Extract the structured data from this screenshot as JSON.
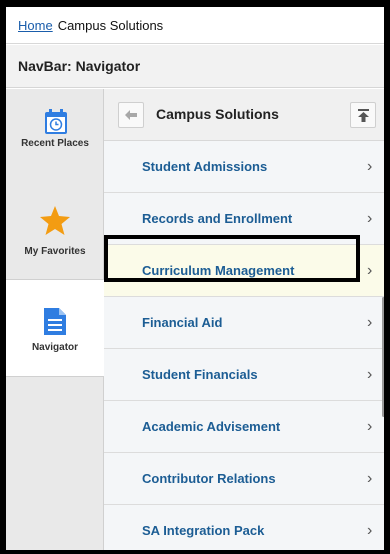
{
  "breadcrumb": {
    "home": "Home",
    "current": "Campus Solutions"
  },
  "navbar": {
    "title": "NavBar: Navigator"
  },
  "sidebar": {
    "items": [
      {
        "label": "Recent Places",
        "icon": "calendar-clock-icon"
      },
      {
        "label": "My Favorites",
        "icon": "star-icon"
      },
      {
        "label": "Navigator",
        "icon": "document-icon"
      }
    ]
  },
  "main": {
    "title": "Campus Solutions",
    "items": [
      {
        "label": "Student Admissions",
        "chevron": "›"
      },
      {
        "label": "Records and Enrollment",
        "chevron": "›"
      },
      {
        "label": "Curriculum Management",
        "chevron": "›"
      },
      {
        "label": "Financial Aid",
        "chevron": "›"
      },
      {
        "label": "Student Financials",
        "chevron": "›"
      },
      {
        "label": "Academic Advisement",
        "chevron": "›"
      },
      {
        "label": "Contributor Relations",
        "chevron": "›"
      },
      {
        "label": "SA Integration Pack",
        "chevron": "›"
      }
    ]
  },
  "colors": {
    "link": "#1c5d94",
    "star": "#f39c12",
    "icon_blue": "#2f7de1",
    "highlight": "#fbfbe9"
  }
}
